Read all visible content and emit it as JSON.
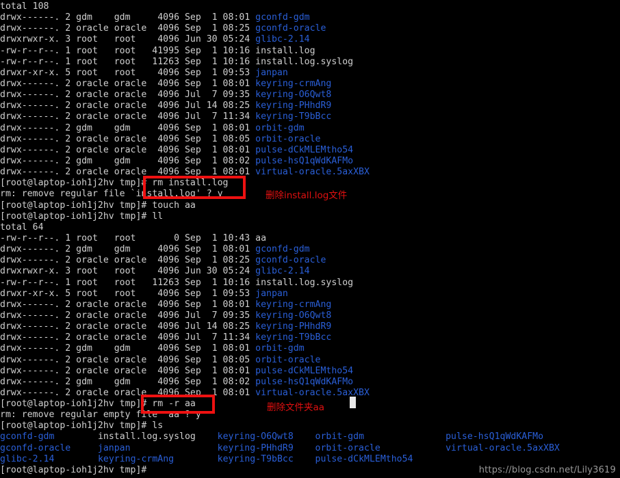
{
  "terminal": {
    "prompt": "[root@laptop-ioh1j2hv tmp]# ",
    "colors": {
      "background": "#000000",
      "foreground": "#d0d0d0",
      "directory": "#2a5fd8",
      "annotation": "#e01010",
      "box_border": "#ee1111",
      "watermark": "#9a9a9a"
    },
    "lines": [
      {
        "id": "l01",
        "text": "total 108",
        "type": "output"
      },
      {
        "id": "l02",
        "meta": "drwx------. 2 gdm    gdm     4096 Sep  1 08:01 ",
        "name": "gconfd-gdm",
        "type": "listing",
        "color": "dir"
      },
      {
        "id": "l03",
        "meta": "drwx------. 2 oracle oracle  4096 Sep  1 08:25 ",
        "name": "gconfd-oracle",
        "type": "listing",
        "color": "dir"
      },
      {
        "id": "l04",
        "meta": "drwxrwxr-x. 3 root   root    4096 Jun 30 05:24 ",
        "name": "glibc-2.14",
        "type": "listing",
        "color": "dir"
      },
      {
        "id": "l05",
        "meta": "-rw-r--r--. 1 root   root   41995 Sep  1 10:16 ",
        "name": "install.log",
        "type": "listing",
        "color": "w"
      },
      {
        "id": "l06",
        "meta": "-rw-r--r--. 1 root   root   11263 Sep  1 10:16 ",
        "name": "install.log.syslog",
        "type": "listing",
        "color": "w"
      },
      {
        "id": "l07",
        "meta": "drwxr-xr-x. 5 root   root    4096 Sep  1 09:53 ",
        "name": "janpan",
        "type": "listing",
        "color": "dir"
      },
      {
        "id": "l08",
        "meta": "drwx------. 2 oracle oracle  4096 Sep  1 08:01 ",
        "name": "keyring-crmAng",
        "type": "listing",
        "color": "dir"
      },
      {
        "id": "l09",
        "meta": "drwx------. 2 oracle oracle  4096 Jul  7 09:35 ",
        "name": "keyring-O6Qwt8",
        "type": "listing",
        "color": "dir"
      },
      {
        "id": "l10",
        "meta": "drwx------. 2 oracle oracle  4096 Jul 14 08:25 ",
        "name": "keyring-PHhdR9",
        "type": "listing",
        "color": "dir"
      },
      {
        "id": "l11",
        "meta": "drwx------. 2 oracle oracle  4096 Jul  7 11:34 ",
        "name": "keyring-T9bBcc",
        "type": "listing",
        "color": "dir"
      },
      {
        "id": "l12",
        "meta": "drwx------. 2 gdm    gdm     4096 Sep  1 08:01 ",
        "name": "orbit-gdm",
        "type": "listing",
        "color": "dir"
      },
      {
        "id": "l13",
        "meta": "drwx------. 2 oracle oracle  4096 Sep  1 08:05 ",
        "name": "orbit-oracle",
        "type": "listing",
        "color": "dir"
      },
      {
        "id": "l14",
        "meta": "drwx------. 2 oracle oracle  4096 Sep  1 08:01 ",
        "name": "pulse-dCkMLEMtho54",
        "type": "listing",
        "color": "dir"
      },
      {
        "id": "l15",
        "meta": "drwx------. 2 gdm    gdm     4096 Sep  1 08:02 ",
        "name": "pulse-hsQ1qWdKAFMo",
        "type": "listing",
        "color": "dir"
      },
      {
        "id": "l16",
        "meta": "drwx------. 2 oracle oracle  4096 Sep  1 08:01 ",
        "name": "virtual-oracle.5axXBX",
        "type": "listing",
        "color": "dir"
      },
      {
        "id": "l17",
        "text": "[root@laptop-ioh1j2hv tmp]# rm install.log",
        "type": "command"
      },
      {
        "id": "l18",
        "text": "rm: remove regular file `install.log' ? y",
        "type": "output"
      },
      {
        "id": "l19",
        "text": "[root@laptop-ioh1j2hv tmp]# touch aa",
        "type": "command"
      },
      {
        "id": "l20",
        "text": "[root@laptop-ioh1j2hv tmp]# ll",
        "type": "command"
      },
      {
        "id": "l21",
        "text": "total 64",
        "type": "output"
      },
      {
        "id": "l22",
        "meta": "-rw-r--r--. 1 root   root       0 Sep  1 10:43 ",
        "name": "aa",
        "type": "listing",
        "color": "w"
      },
      {
        "id": "l23",
        "meta": "drwx------. 2 gdm    gdm     4096 Sep  1 08:01 ",
        "name": "gconfd-gdm",
        "type": "listing",
        "color": "dir"
      },
      {
        "id": "l24",
        "meta": "drwx------. 2 oracle oracle  4096 Sep  1 08:25 ",
        "name": "gconfd-oracle",
        "type": "listing",
        "color": "dir"
      },
      {
        "id": "l25",
        "meta": "drwxrwxr-x. 3 root   root    4096 Jun 30 05:24 ",
        "name": "glibc-2.14",
        "type": "listing",
        "color": "dir"
      },
      {
        "id": "l26",
        "meta": "-rw-r--r--. 1 root   root   11263 Sep  1 10:16 ",
        "name": "install.log.syslog",
        "type": "listing",
        "color": "w"
      },
      {
        "id": "l27",
        "meta": "drwxr-xr-x. 5 root   root    4096 Sep  1 09:53 ",
        "name": "janpan",
        "type": "listing",
        "color": "dir"
      },
      {
        "id": "l28",
        "meta": "drwx------. 2 oracle oracle  4096 Sep  1 08:01 ",
        "name": "keyring-crmAng",
        "type": "listing",
        "color": "dir"
      },
      {
        "id": "l29",
        "meta": "drwx------. 2 oracle oracle  4096 Jul  7 09:35 ",
        "name": "keyring-O6Qwt8",
        "type": "listing",
        "color": "dir"
      },
      {
        "id": "l30",
        "meta": "drwx------. 2 oracle oracle  4096 Jul 14 08:25 ",
        "name": "keyring-PHhdR9",
        "type": "listing",
        "color": "dir"
      },
      {
        "id": "l31",
        "meta": "drwx------. 2 oracle oracle  4096 Jul  7 11:34 ",
        "name": "keyring-T9bBcc",
        "type": "listing",
        "color": "dir"
      },
      {
        "id": "l32",
        "meta": "drwx------. 2 gdm    gdm     4096 Sep  1 08:01 ",
        "name": "orbit-gdm",
        "type": "listing",
        "color": "dir"
      },
      {
        "id": "l33",
        "meta": "drwx------. 2 oracle oracle  4096 Sep  1 08:05 ",
        "name": "orbit-oracle",
        "type": "listing",
        "color": "dir"
      },
      {
        "id": "l34",
        "meta": "drwx------. 2 oracle oracle  4096 Sep  1 08:01 ",
        "name": "pulse-dCkMLEMtho54",
        "type": "listing",
        "color": "dir"
      },
      {
        "id": "l35",
        "meta": "drwx------. 2 gdm    gdm     4096 Sep  1 08:02 ",
        "name": "pulse-hsQ1qWdKAFMo",
        "type": "listing",
        "color": "dir"
      },
      {
        "id": "l36",
        "meta": "drwx------. 2 oracle oracle  4096 Sep  1 08:01 ",
        "name": "virtual-oracle.5axXBX",
        "type": "listing",
        "color": "dir"
      },
      {
        "id": "l37",
        "text": "[root@laptop-ioh1j2hv tmp]# rm -r aa",
        "type": "command"
      },
      {
        "id": "l38",
        "text": "rm: remove regular empty file  aa ? y",
        "type": "output"
      },
      {
        "id": "l39",
        "text": "[root@laptop-ioh1j2hv tmp]# ls",
        "type": "command"
      }
    ],
    "ls_columns": [
      {
        "id": "c1",
        "items": [
          "gconfd-gdm",
          "gconfd-oracle",
          "glibc-2.14"
        ],
        "color": "dir"
      },
      {
        "id": "c2",
        "items": [
          "install.log.syslog",
          "janpan",
          "keyring-crmAng"
        ],
        "color": "mixed",
        "item_colors": [
          "w",
          "dir",
          "dir"
        ]
      },
      {
        "id": "c3",
        "items": [
          "keyring-O6Qwt8",
          "keyring-PHhdR9",
          "keyring-T9bBcc"
        ],
        "color": "dir"
      },
      {
        "id": "c4",
        "items": [
          "orbit-gdm",
          "orbit-oracle",
          "pulse-dCkMLEMtho54"
        ],
        "color": "dir"
      },
      {
        "id": "c5",
        "items": [
          "pulse-hsQ1qWdKAFMo",
          "virtual-oracle.5axXBX",
          ""
        ],
        "color": "dir"
      }
    ],
    "final_prompt": "[root@laptop-ioh1j2hv tmp]#"
  },
  "annotations": {
    "install_log_note": "删除install.log文件",
    "folder_aa_note": "删除文件夹aa"
  },
  "watermark": {
    "text": "https://blog.csdn.net/Lily3619"
  }
}
